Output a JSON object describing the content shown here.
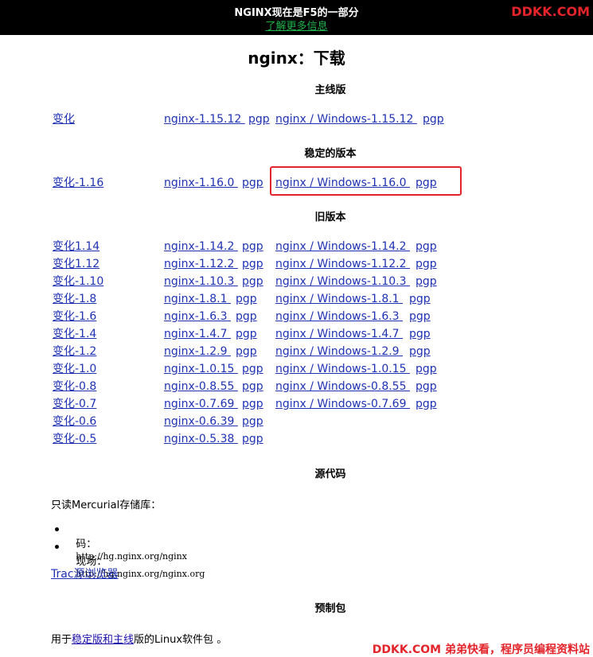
{
  "banner": {
    "title": "NGINX现在是F5的一部分",
    "link": "了解更多信息",
    "brand": "DDKK.COM"
  },
  "page_title": "nginx：下载",
  "mainline": {
    "heading": "主线版",
    "row": {
      "changes": "变化",
      "src": "nginx-1.15.12 ",
      "pgp1": "pgp",
      "win": "nginx / Windows-1.15.12 ",
      "pgp2": "pgp"
    }
  },
  "stable": {
    "heading": "稳定的版本",
    "row": {
      "changes": "变化-1.16",
      "src": "nginx-1.16.0 ",
      "pgp1": "pgp",
      "win": "nginx / Windows-1.16.0 ",
      "pgp2": "pgp"
    }
  },
  "legacy": {
    "heading": "旧版本",
    "rows": [
      {
        "changes": "变化1.14",
        "src": "nginx-1.14.2 ",
        "pgp1": "pgp",
        "win": "nginx / Windows-1.14.2 ",
        "pgp2": "pgp"
      },
      {
        "changes": "变化1.12",
        "src": "nginx-1.12.2 ",
        "pgp1": "pgp",
        "win": "nginx / Windows-1.12.2 ",
        "pgp2": "pgp"
      },
      {
        "changes": "变化-1.10",
        "src": "nginx-1.10.3 ",
        "pgp1": "pgp",
        "win": "nginx / Windows-1.10.3 ",
        "pgp2": "pgp"
      },
      {
        "changes": "变化-1.8",
        "src": "nginx-1.8.1 ",
        "pgp1": "pgp",
        "win": "nginx / Windows-1.8.1 ",
        "pgp2": "pgp"
      },
      {
        "changes": "变化-1.6",
        "src": "nginx-1.6.3 ",
        "pgp1": "pgp",
        "win": "nginx / Windows-1.6.3 ",
        "pgp2": "pgp"
      },
      {
        "changes": "变化-1.4",
        "src": "nginx-1.4.7 ",
        "pgp1": "pgp",
        "win": "nginx / Windows-1.4.7 ",
        "pgp2": "pgp"
      },
      {
        "changes": "变化-1.2",
        "src": "nginx-1.2.9 ",
        "pgp1": "pgp",
        "win": "nginx / Windows-1.2.9 ",
        "pgp2": "pgp"
      },
      {
        "changes": "变化-1.0",
        "src": "nginx-1.0.15 ",
        "pgp1": "pgp",
        "win": "nginx / Windows-1.0.15 ",
        "pgp2": "pgp"
      },
      {
        "changes": "变化-0.8",
        "src": "nginx-0.8.55 ",
        "pgp1": "pgp",
        "win": "nginx / Windows-0.8.55 ",
        "pgp2": "pgp"
      },
      {
        "changes": "变化-0.7",
        "src": "nginx-0.7.69 ",
        "pgp1": "pgp",
        "win": "nginx / Windows-0.7.69 ",
        "pgp2": "pgp"
      },
      {
        "changes": "变化-0.6",
        "src": "nginx-0.6.39 ",
        "pgp1": "pgp"
      },
      {
        "changes": "变化-0.5",
        "src": "nginx-0.5.38 ",
        "pgp1": "pgp"
      }
    ]
  },
  "source": {
    "heading": "源代码",
    "intro": "只读Mercurial存储库：",
    "items": [
      {
        "label": "码：",
        "url": "http://hg.nginx.org/nginx"
      },
      {
        "label": "现场：",
        "url": "http://hg.nginx.org/nginx.org"
      }
    ],
    "trac_link": "Trac源浏览器"
  },
  "packages": {
    "heading": "预制包",
    "prefix": "用于",
    "link": "稳定版和主线",
    "suffix": "版的Linux软件包 。"
  },
  "footer_brand": "DDKK.COM 弟弟快看，程序员编程资料站"
}
